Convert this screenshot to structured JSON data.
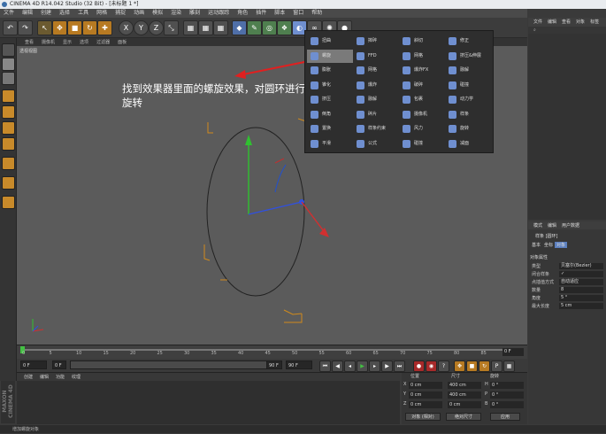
{
  "window": {
    "title": "CINEMA 4D R14.042 Studio (32 Bit) - [未标题 1 *]"
  },
  "menubar": [
    "文件",
    "编辑",
    "创建",
    "选择",
    "工具",
    "网格",
    "捕捉",
    "动画",
    "模拟",
    "渲染",
    "雕刻",
    "运动跟踪",
    "角色",
    "插件",
    "脚本",
    "窗口",
    "帮助"
  ],
  "toolbar": {
    "xyz": [
      "X",
      "Y",
      "Z"
    ]
  },
  "viewport": {
    "menu": [
      "查看",
      "摄像机",
      "显示",
      "选项",
      "过滤器",
      "面板"
    ],
    "label": "透视视图",
    "annotation": "找到效果器里面的螺旋效果，对圆环进行螺旋旋转"
  },
  "deformer_menu": {
    "columns": [
      [
        "扭曲",
        "螺旋",
        "膨胀",
        "锥化",
        "挤压",
        "倒角",
        "置换",
        "平滑"
      ],
      [
        "摔碎",
        "FFD",
        "网格",
        "爆炸",
        "融解",
        "碎片",
        "样条约束",
        "公式"
      ],
      [
        "斜切",
        "网格",
        "爆炸FX",
        "破碎",
        "包裹",
        "摄像机",
        "风力",
        "碰撞"
      ],
      [
        "修正",
        "挤压&伸展",
        "融解",
        "碰撞",
        "动力学",
        "样条",
        "旋转",
        "减面"
      ]
    ],
    "selected": "螺旋"
  },
  "timeline": {
    "ticks": [
      "0",
      "5",
      "10",
      "15",
      "20",
      "25",
      "30",
      "35",
      "40",
      "45",
      "50",
      "55",
      "60",
      "65",
      "70",
      "75",
      "80",
      "85",
      "90"
    ],
    "frame": "0 F"
  },
  "playback": {
    "start": "0 F",
    "current": "0 F",
    "end": "90 F",
    "end2": "90 F"
  },
  "material": {
    "menu": [
      "创建",
      "编辑",
      "功能",
      "纹理"
    ]
  },
  "coordinates": {
    "headers": [
      "位置",
      "尺寸",
      "旋转"
    ],
    "rows": [
      {
        "axis": "X",
        "pos": "0 cm",
        "size": "400 cm",
        "rot_axis": "H",
        "rot": "0 °"
      },
      {
        "axis": "Y",
        "pos": "0 cm",
        "size": "400 cm",
        "rot_axis": "P",
        "rot": "0 °"
      },
      {
        "axis": "Z",
        "pos": "0 cm",
        "size": "0 cm",
        "rot_axis": "B",
        "rot": "0 °"
      }
    ],
    "mode_object": "对象 (相对)",
    "mode_size": "绝对尺寸",
    "apply": "应用"
  },
  "objects_panel": {
    "tabs": [
      "文件",
      "编辑",
      "查看",
      "对象",
      "标签"
    ]
  },
  "attributes_panel": {
    "tabs": [
      "模式",
      "编辑",
      "用户数据"
    ],
    "object_name": "样条 [圆环]",
    "subtabs": [
      "基本",
      "坐标",
      "对象"
    ],
    "section": "对象属性",
    "fields": [
      {
        "label": "类型",
        "value": "贝塞尔(Bezier)"
      },
      {
        "label": "闭合样条",
        "value": "✓"
      },
      {
        "label": "点插值方式",
        "value": "自动适应"
      },
      {
        "label": "数量",
        "value": "8"
      },
      {
        "label": "角度",
        "value": "5 °"
      },
      {
        "label": "最大长度",
        "value": "5 cm"
      }
    ]
  },
  "statusbar": {
    "text": "增加螺旋对象"
  },
  "brand": "MAXON CINEMA 4D",
  "colors": {
    "accent_orange": "#c88a2a",
    "axis_x": "#d03030",
    "axis_y": "#30c030",
    "axis_z": "#3050e0",
    "highlight": "#7a7a7a"
  }
}
